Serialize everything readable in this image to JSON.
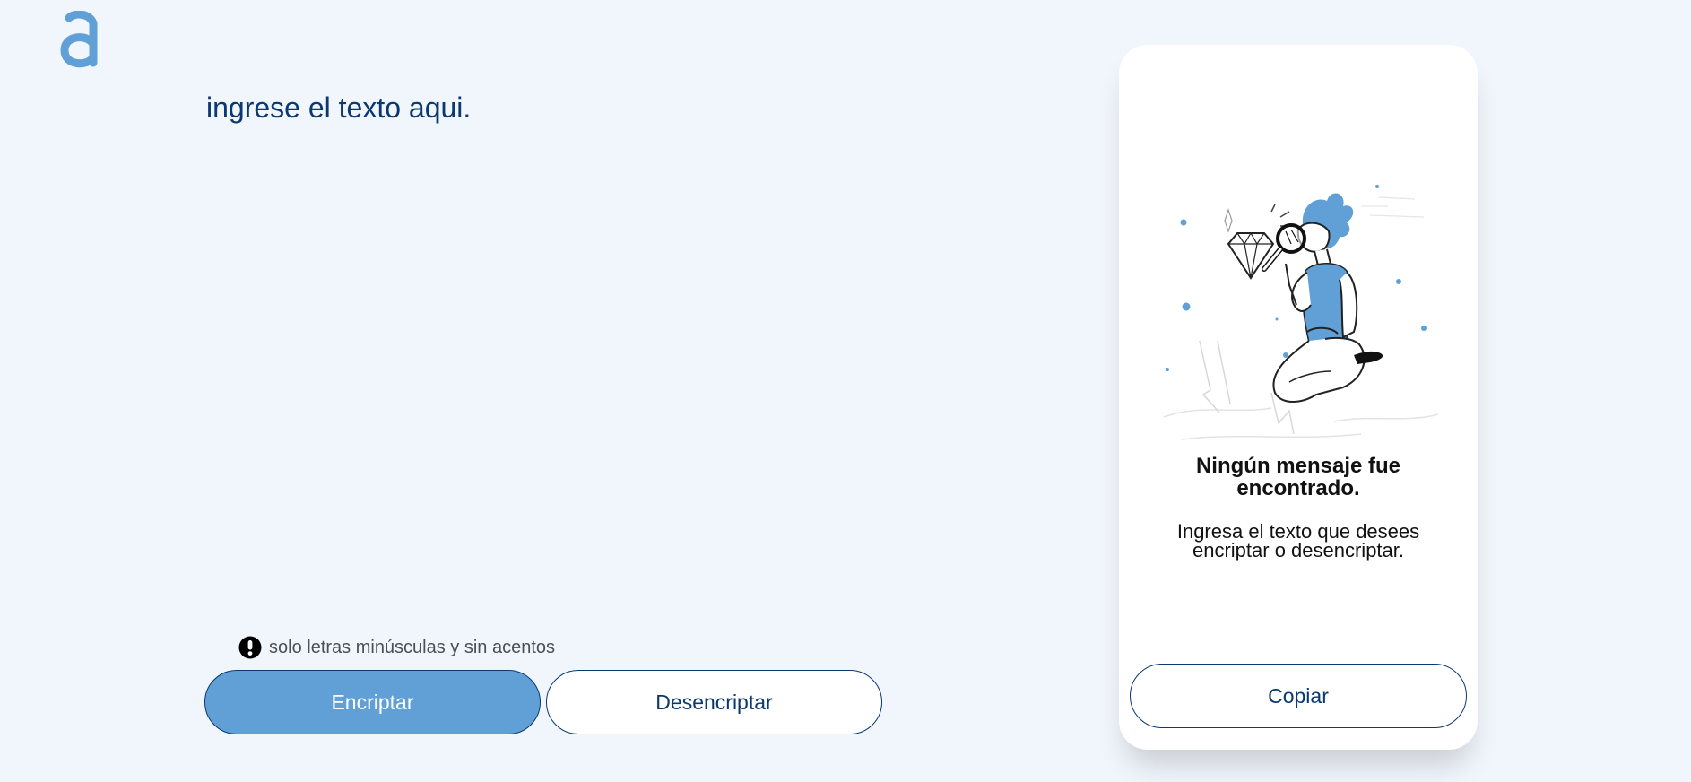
{
  "input": {
    "placeholder": "ingrese el texto aqui.",
    "value": ""
  },
  "hint": {
    "icon": "exclamation-circle-icon",
    "text": "solo letras minúsculas y sin acentos"
  },
  "actions": {
    "encrypt_label": "Encriptar",
    "decrypt_label": "Desencriptar"
  },
  "output": {
    "illustration": "person-with-magnifying-glass-illustration",
    "empty_title": "Ningún mensaje fue encontrado.",
    "empty_text": "Ingresa el texto que desees encriptar o desencriptar.",
    "copy_label": "Copiar"
  },
  "colors": {
    "background": "#f1f5fc",
    "primary": "#0a3871",
    "accent": "#60a0d6"
  }
}
